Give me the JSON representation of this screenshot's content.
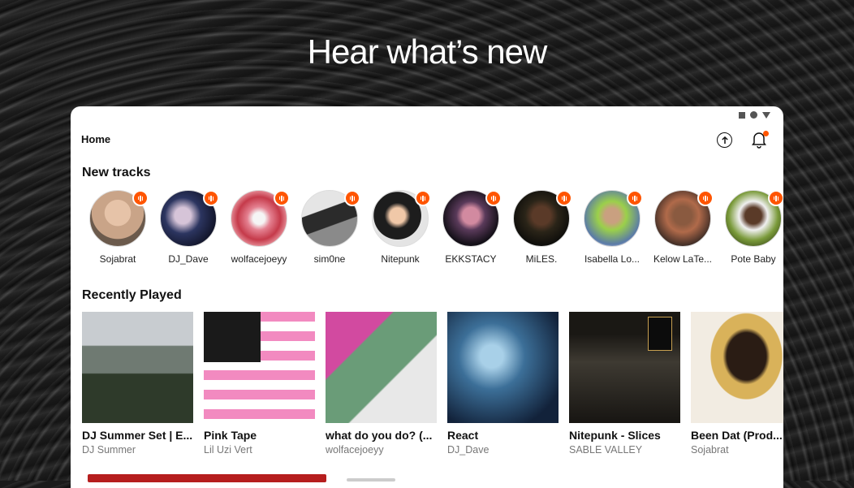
{
  "headline": "Hear what’s new",
  "header": {
    "title": "Home",
    "upload_icon": "upload-icon",
    "bell_icon": "bell-icon"
  },
  "new_tracks": {
    "title": "New tracks",
    "artists": [
      {
        "name": "Sojabrat",
        "color": "#c9a488"
      },
      {
        "name": "DJ_Dave",
        "color": "#2c3560"
      },
      {
        "name": "wolfacejoeyy",
        "color": "#d86a7a"
      },
      {
        "name": "sim0ne",
        "color": "#4a4a4a"
      },
      {
        "name": "Nitepunk",
        "color": "#dadada"
      },
      {
        "name": "EKKSTACY",
        "color": "#2a2130"
      },
      {
        "name": "MiLES.",
        "color": "#1a1a18"
      },
      {
        "name": "Isabella Lo...",
        "color": "#7fa35a"
      },
      {
        "name": "Kelow LaTe...",
        "color": "#b06a4a"
      },
      {
        "name": "Pote Baby",
        "color": "#7a9a3a"
      }
    ]
  },
  "recently_played": {
    "title": "Recently Played",
    "items": [
      {
        "title": "DJ Summer Set | E...",
        "artist": "DJ Summer",
        "color": "#4f5a4a"
      },
      {
        "title": "Pink Tape",
        "artist": "Lil Uzi Vert",
        "color": "#f09cc6"
      },
      {
        "title": "what do you do? (...",
        "artist": "wolfacejoeyy",
        "color": "#6a9c78"
      },
      {
        "title": "React",
        "artist": "DJ_Dave",
        "color": "#3c6f98"
      },
      {
        "title": "Nitepunk - Slices",
        "artist": "SABLE VALLEY",
        "color": "#2e2c28"
      },
      {
        "title": "Been Dat (Prod...",
        "artist": "Sojabrat",
        "color": "#d9b25a"
      }
    ]
  },
  "accent_color": "#ff5500"
}
